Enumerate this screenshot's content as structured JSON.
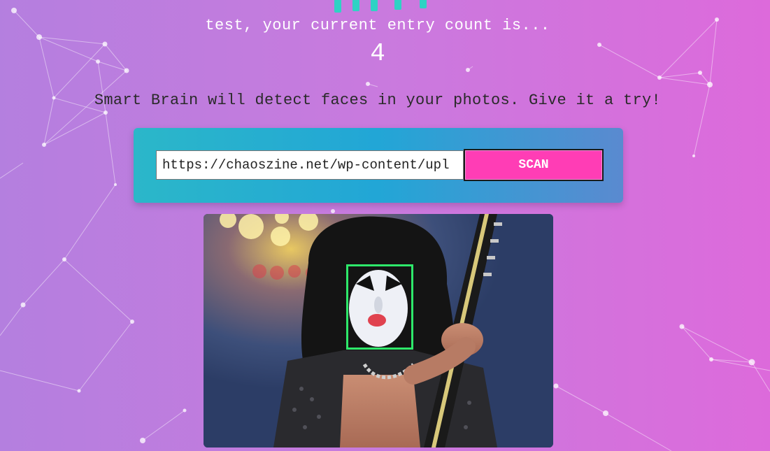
{
  "app": {
    "logo_icon": "brain-logo-icon"
  },
  "rank": {
    "text": "test, your current entry count is...",
    "count": "4"
  },
  "tagline": "Smart Brain will detect faces in your photos. Give it a try!",
  "image_link_form": {
    "input_value": "https://chaoszine.net/wp-content/upl",
    "button_label": "SCAN"
  },
  "face_recognition": {
    "image_subject": "performer with white face paint holding a guitar",
    "detected_faces": 1,
    "box_color": "#2ee86a"
  },
  "colors": {
    "background_start": "#b47fdf",
    "background_end": "#dd6adb",
    "panel_start": "#2bb7c9",
    "panel_end": "#5a8ad0",
    "button": "#ff3db5"
  }
}
